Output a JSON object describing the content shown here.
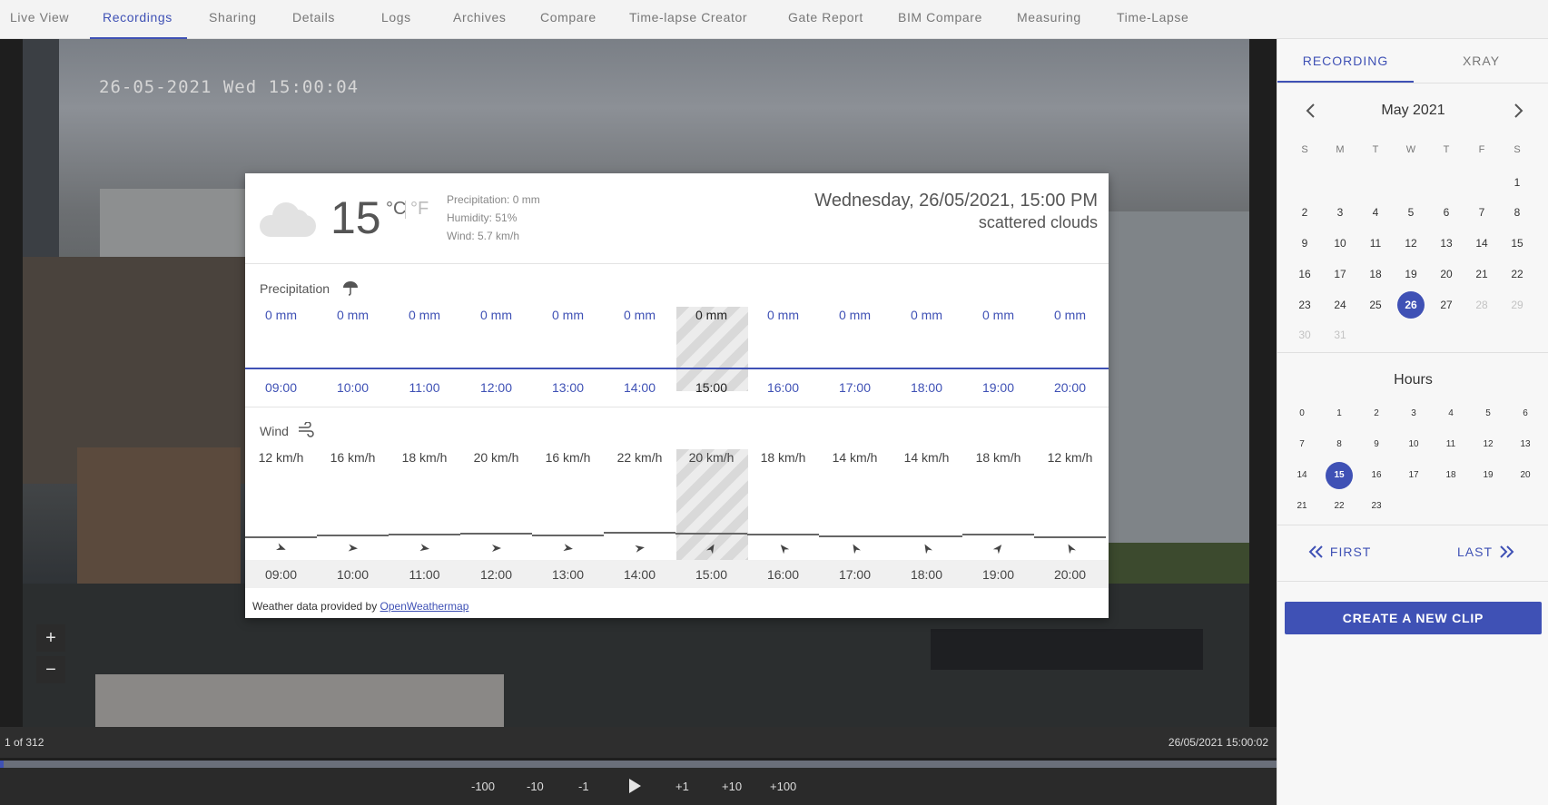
{
  "nav": {
    "tabs": [
      "Live View",
      "Recordings",
      "Sharing",
      "Details",
      "Logs",
      "Archives",
      "Compare",
      "Time-lapse Creator",
      "Gate Report",
      "BIM Compare",
      "Measuring",
      "Time-Lapse"
    ],
    "active": "Recordings"
  },
  "camera": {
    "timestamp": "26-05-2021 Wed 15:00:04",
    "zoom_in": "+",
    "zoom_out": "−"
  },
  "player": {
    "frame_counter": "1 of 312",
    "frame_time": "26/05/2021 15:00:02",
    "progress_fraction": 0.003,
    "controls": [
      "-100",
      "-10",
      "-1",
      "+1",
      "+10",
      "+100"
    ],
    "play_icon": "play-icon"
  },
  "weather": {
    "temperature": "15",
    "unit_c": "°C",
    "unit_f": "°F",
    "precipitation_line": "Precipitation: 0 mm",
    "humidity_line": "Humidity: 51%",
    "wind_line": "Wind: 5.7 km/h",
    "datetime": "Wednesday, 26/05/2021, 15:00 PM",
    "description": "scattered clouds",
    "precip_title": "Precipitation",
    "wind_title": "Wind",
    "hours": [
      "09:00",
      "10:00",
      "11:00",
      "12:00",
      "13:00",
      "14:00",
      "15:00",
      "16:00",
      "17:00",
      "18:00",
      "19:00",
      "20:00"
    ],
    "precip_values": [
      "0 mm",
      "0 mm",
      "0 mm",
      "0 mm",
      "0 mm",
      "0 mm",
      "0 mm",
      "0 mm",
      "0 mm",
      "0 mm",
      "0 mm",
      "0 mm"
    ],
    "wind_values": [
      "12 km/h",
      "16 km/h",
      "18 km/h",
      "20 km/h",
      "16 km/h",
      "22 km/h",
      "20 km/h",
      "18 km/h",
      "14 km/h",
      "14 km/h",
      "18 km/h",
      "12 km/h"
    ],
    "wind_speeds": [
      12,
      16,
      18,
      20,
      16,
      22,
      20,
      18,
      14,
      14,
      18,
      12
    ],
    "wind_directions_deg": [
      110,
      95,
      100,
      90,
      100,
      80,
      30,
      320,
      330,
      330,
      40,
      330
    ],
    "selected_index": 6,
    "footer_prefix": "Weather data provided by",
    "footer_link": "OpenWeathermap"
  },
  "sidebar": {
    "tabs": [
      "RECORDING",
      "XRAY"
    ],
    "month": "May 2021",
    "weekdays": [
      "S",
      "M",
      "T",
      "W",
      "T",
      "F",
      "S"
    ],
    "first_weekday_index": 6,
    "days_in_month": 31,
    "selected_day": 26,
    "disabled_days": [
      28,
      29,
      30,
      31
    ],
    "hours_title": "Hours",
    "selected_hour": 15,
    "first_label": "FIRST",
    "last_label": "LAST",
    "create_clip": "CREATE A NEW CLIP"
  }
}
